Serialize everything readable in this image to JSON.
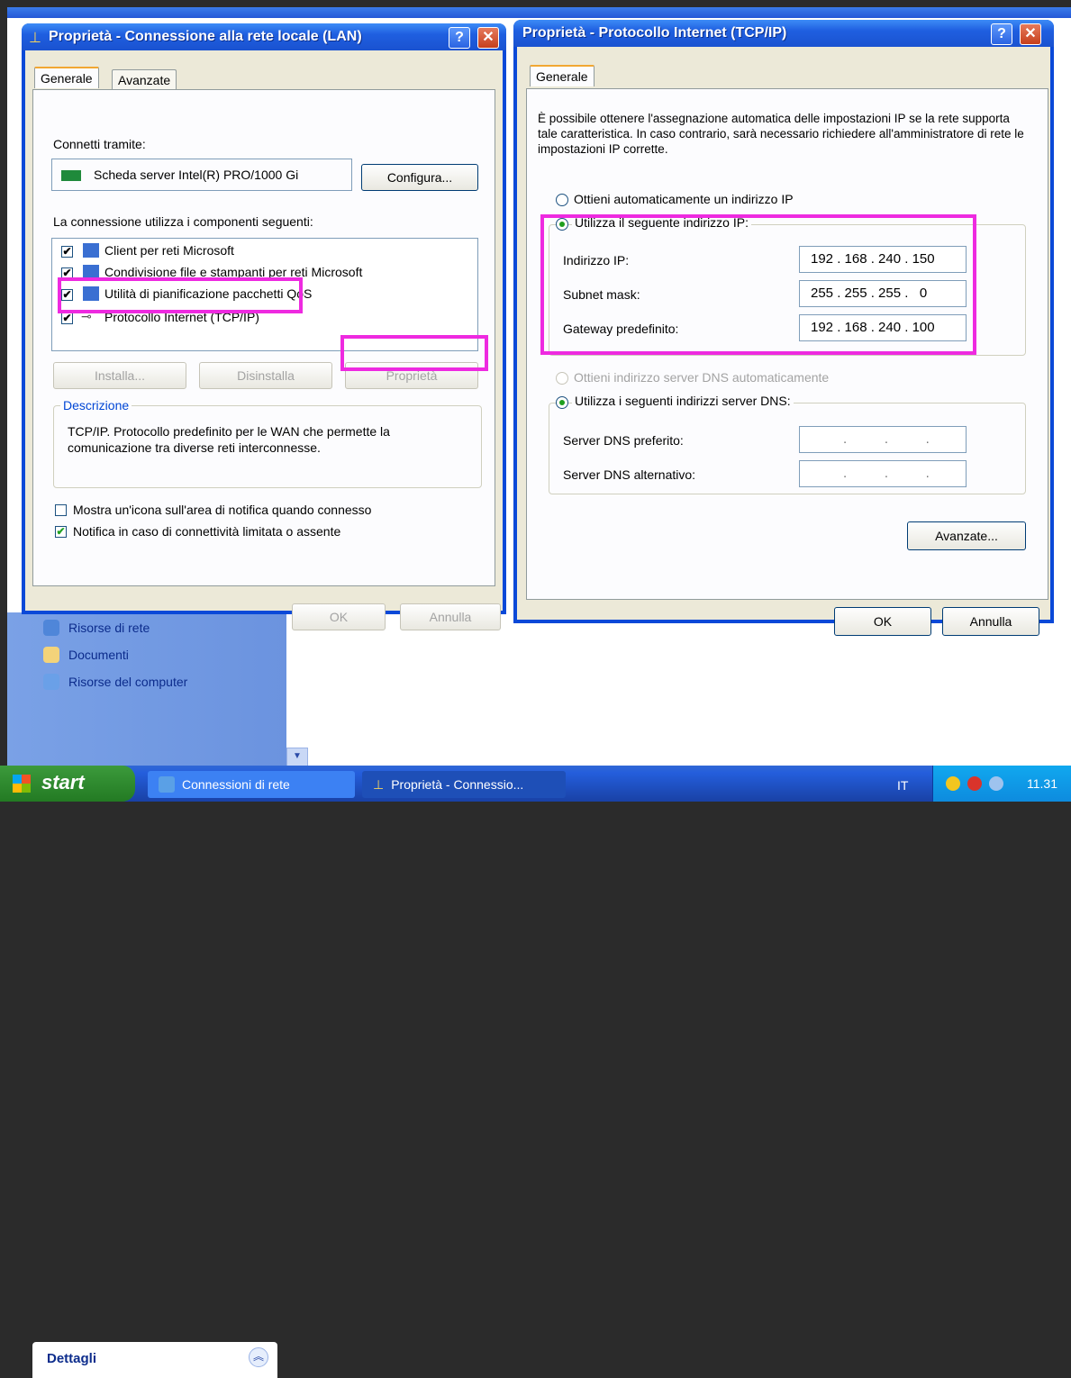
{
  "lan_window": {
    "title": "Proprietà - Connessione alla rete locale (LAN)",
    "tabs": [
      "Generale",
      "Avanzate"
    ],
    "connect_using_label": "Connetti tramite:",
    "adapter_name": "Scheda server Intel(R) PRO/1000 Gi",
    "configure_button": "Configura...",
    "components_label": "La connessione utilizza i componenti seguenti:",
    "components": [
      {
        "label": "Client per reti Microsoft",
        "checked": true
      },
      {
        "label": "Condivisione file e stampanti per reti Microsoft",
        "checked": true
      },
      {
        "label": "Utilità di pianificazione pacchetti QoS",
        "checked": true
      },
      {
        "label": "Protocollo Internet (TCP/IP)",
        "checked": true
      }
    ],
    "install_button": "Installa...",
    "uninstall_button": "Disinstalla",
    "properties_button": "Proprietà",
    "description_legend": "Descrizione",
    "description_text": "TCP/IP. Protocollo predefinito per le WAN che permette la comunicazione tra diverse reti interconnesse.",
    "show_icon_label": "Mostra un'icona sull'area di notifica quando connesso",
    "notify_label": "Notifica in caso di connettività limitata o assente",
    "ok_button": "OK",
    "cancel_button": "Annulla"
  },
  "tcp_window": {
    "title": "Proprietà - Protocollo Internet (TCP/IP)",
    "tab": "Generale",
    "intro_text": "È possibile ottenere l'assegnazione automatica delle impostazioni IP se la rete supporta tale caratteristica. In caso contrario, sarà necessario richiedere all'amministratore di rete le impostazioni IP corrette.",
    "auto_ip_label": "Ottieni automaticamente un indirizzo IP",
    "manual_ip_label": "Utilizza il seguente indirizzo IP:",
    "ip_label": "Indirizzo IP:",
    "ip_value": "192 . 168 . 240 . 150",
    "mask_label": "Subnet mask:",
    "mask_value": "255 . 255 . 255 .   0",
    "gateway_label": "Gateway predefinito:",
    "gateway_value": "192 . 168 . 240 . 100",
    "auto_dns_label": "Ottieni indirizzo server DNS automaticamente",
    "manual_dns_label": "Utilizza i seguenti indirizzi server DNS:",
    "dns_pref_label": "Server DNS preferito:",
    "dns_alt_label": "Server DNS alternativo:",
    "dns_empty": ".          .          .",
    "advanced_button": "Avanzate...",
    "ok_button": "OK",
    "cancel_button": "Annulla"
  },
  "background": {
    "tasks": [
      "Risorse di rete",
      "Documenti",
      "Risorse del computer"
    ],
    "details_title": "Dettagli"
  },
  "taskbar": {
    "start_label": "start",
    "items": [
      "Connessioni di rete",
      "Proprietà - Connessio..."
    ],
    "language": "IT",
    "clock": "11.31"
  },
  "colors": {
    "highlight": "#ee2ae0",
    "xp_blue": "#0a49d8"
  }
}
